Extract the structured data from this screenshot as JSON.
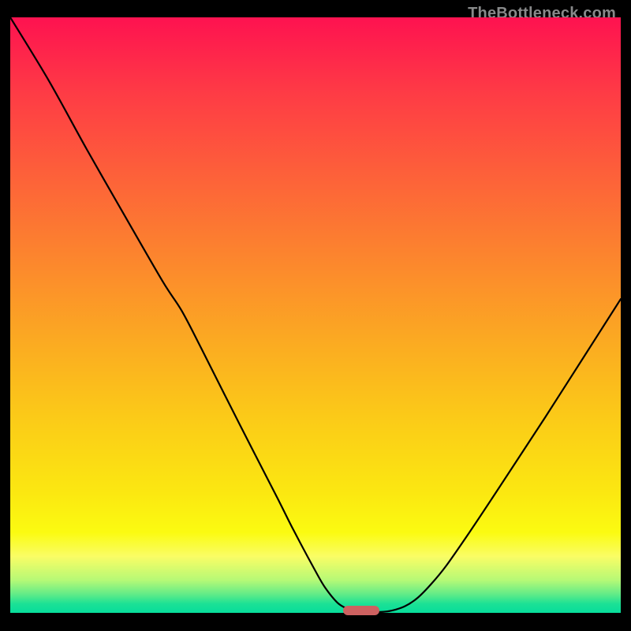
{
  "watermark": "TheBottleneck.com",
  "colors": {
    "bg": "#000000",
    "curve": "#000000",
    "marker": "#cd6160",
    "gradient_stops": [
      {
        "offset": 0.0,
        "color": "#fe1250"
      },
      {
        "offset": 0.13,
        "color": "#fe3c45"
      },
      {
        "offset": 0.27,
        "color": "#fd6239"
      },
      {
        "offset": 0.41,
        "color": "#fc872d"
      },
      {
        "offset": 0.54,
        "color": "#fba922"
      },
      {
        "offset": 0.67,
        "color": "#fbca18"
      },
      {
        "offset": 0.8,
        "color": "#fbe811"
      },
      {
        "offset": 0.865,
        "color": "#fbfb11"
      },
      {
        "offset": 0.905,
        "color": "#fafd65"
      },
      {
        "offset": 0.945,
        "color": "#b6f976"
      },
      {
        "offset": 0.968,
        "color": "#64ec87"
      },
      {
        "offset": 0.985,
        "color": "#1be195"
      },
      {
        "offset": 1.0,
        "color": "#07dd9b"
      }
    ]
  },
  "chart_data": {
    "type": "line",
    "title": "",
    "xlabel": "",
    "ylabel": "",
    "xlim": [
      0,
      100
    ],
    "ylim": [
      0,
      100
    ],
    "grid": false,
    "legend": false,
    "series": [
      {
        "name": "bottleneck-curve",
        "x": [
          0.0,
          6.3,
          12.5,
          18.8,
          25.0,
          28.1,
          31.3,
          37.5,
          43.8,
          46.4,
          50.0,
          51.6,
          53.6,
          55.2,
          57.0,
          59.5,
          62.1,
          64.6,
          66.7,
          69.0,
          71.4,
          75.2,
          79.1,
          83.0,
          87.6,
          93.9,
          100.0
        ],
        "y": [
          100.0,
          89.4,
          77.9,
          66.6,
          55.6,
          50.7,
          44.4,
          31.8,
          19.2,
          13.9,
          7.0,
          4.2,
          1.7,
          0.7,
          0.1,
          0.1,
          0.3,
          1.1,
          2.5,
          4.9,
          7.9,
          13.5,
          19.5,
          25.6,
          32.8,
          42.9,
          52.7
        ]
      }
    ],
    "marker": {
      "x": 57.5,
      "y": 0.4
    }
  }
}
